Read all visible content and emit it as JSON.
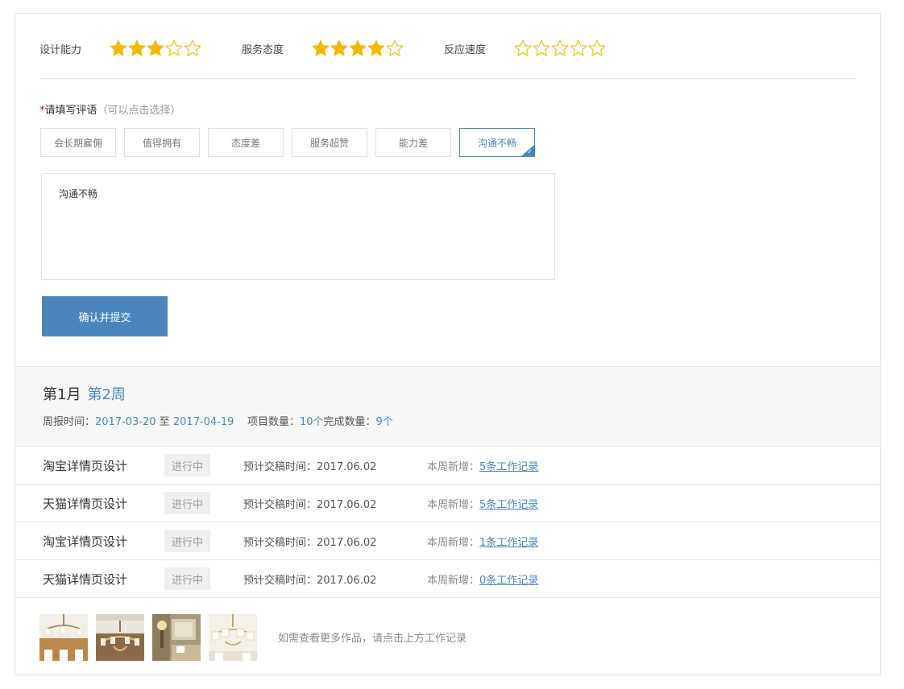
{
  "ratings": [
    {
      "label": "设计能力",
      "value": 3,
      "max": 5
    },
    {
      "label": "服务态度",
      "value": 4,
      "max": 5
    },
    {
      "label": "反应速度",
      "value": 0,
      "max": 5
    }
  ],
  "colors": {
    "star_filled": "#f5b800",
    "star_empty": "#f5c518",
    "accent": "#4a86bd"
  },
  "comment": {
    "required_mark": "*",
    "title": "请填写评语",
    "hint": "（可以点击选择）",
    "tags": [
      "会长期雇佣",
      "值得拥有",
      "态度差",
      "服务超赞",
      "能力差",
      "沟通不畅"
    ],
    "selected_tag": "沟通不畅",
    "text": "沟通不畅",
    "submit_label": "确认并提交"
  },
  "week": {
    "month": "第1月",
    "week": "第2周",
    "report_label": "周报时间：",
    "start": "2017-03-20",
    "to": "至",
    "end": "2017-04-19",
    "project_count_label": "项目数量：",
    "project_count": "10个",
    "done_count_label": "完成数量：",
    "done_count": "9个"
  },
  "projects": [
    {
      "name": "淘宝详情页设计",
      "status": "进行中",
      "due": "预计交稿时间：2017.06.02",
      "weekly_label": "本周新增：",
      "weekly_link": "5条工作记录"
    },
    {
      "name": "天猫详情页设计",
      "status": "进行中",
      "due": "预计交稿时间：2017.06.02",
      "weekly_label": "本周新增：",
      "weekly_link": "5条工作记录"
    },
    {
      "name": "淘宝详情页设计",
      "status": "进行中",
      "due": "预计交稿时间：2017.06.02",
      "weekly_label": "本周新增：",
      "weekly_link": "1条工作记录"
    },
    {
      "name": "天猫详情页设计",
      "status": "进行中",
      "due": "预计交稿时间：2017.06.02",
      "weekly_label": "本周新增：",
      "weekly_link": "0条工作记录"
    }
  ],
  "gallery": {
    "thumbnails": [
      "chandelier-thumb-1",
      "chandelier-thumb-2",
      "interior-thumb-3",
      "chandelier-thumb-4"
    ],
    "note": "如需查看更多作品，请点击上方工作记录"
  }
}
